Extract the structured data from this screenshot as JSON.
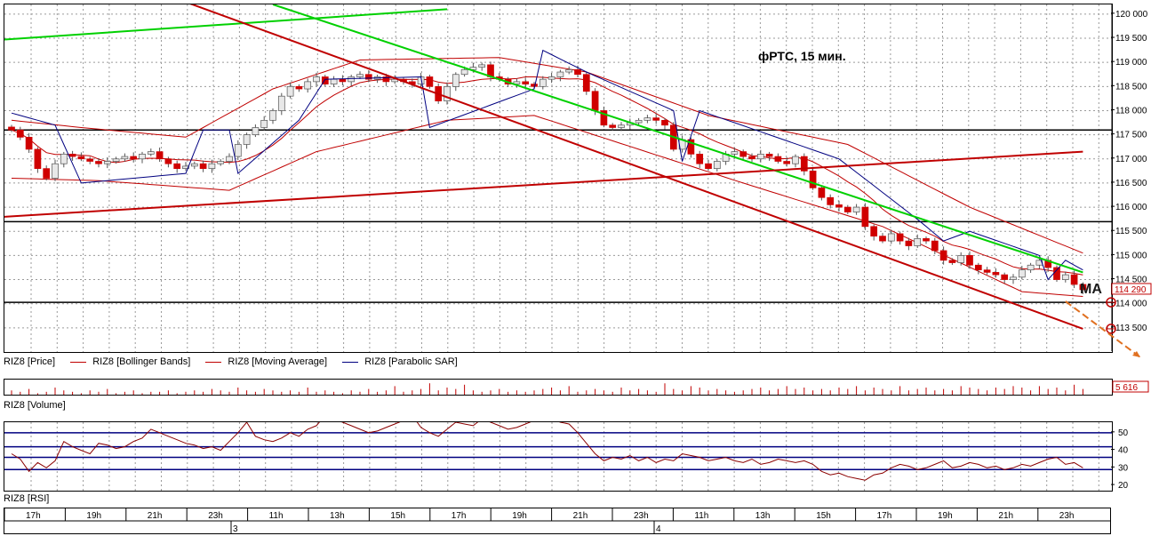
{
  "chart_data": [
    {
      "panel": "price",
      "type": "candlestick",
      "title": "фРТС, 15 мин.",
      "annotation": "MA",
      "ylim": [
        113000,
        120200
      ],
      "y_ticks": [
        113500,
        114000,
        114500,
        115000,
        115500,
        116000,
        116500,
        117000,
        117500,
        118000,
        118500,
        119000,
        119500,
        120000
      ],
      "y_tick_labels": [
        "113 500",
        "114 000",
        "114 500",
        "115 000",
        "115 500",
        "116 000",
        "116 500",
        "117 000",
        "117 500",
        "118 000",
        "118 500",
        "119 000",
        "119 500",
        "120 000"
      ],
      "last_price_label": "114 290",
      "last_price": 114290,
      "horizontal_levels": [
        117600,
        115700,
        114030
      ],
      "grid": true,
      "legend": [
        "RIZ8 [Price]",
        "RIZ8 [Bollinger Bands]",
        "RIZ8 [Moving Average]",
        "RIZ8 [Parabolic SAR]"
      ],
      "close": [
        117600,
        117450,
        117200,
        116800,
        116600,
        116900,
        117100,
        117050,
        117000,
        116950,
        116900,
        116950,
        117000,
        117050,
        117000,
        117100,
        117150,
        117000,
        116900,
        116800,
        116850,
        116900,
        116800,
        116900,
        116950,
        117050,
        117300,
        117500,
        117650,
        117800,
        118000,
        118300,
        118500,
        118450,
        118600,
        118700,
        118550,
        118650,
        118600,
        118700,
        118750,
        118650,
        118700,
        118600,
        118650,
        118600,
        118550,
        118700,
        118500,
        118200,
        118500,
        118750,
        118850,
        118900,
        118950,
        118700,
        118650,
        118550,
        118600,
        118550,
        118500,
        118650,
        118700,
        118800,
        118850,
        118750,
        118400,
        118000,
        117700,
        117650,
        117700,
        117750,
        117800,
        117850,
        117800,
        117700,
        117200,
        117400,
        117100,
        116900,
        116800,
        116950,
        117100,
        117150,
        117050,
        117000,
        117100,
        117050,
        116950,
        116900,
        117050,
        116750,
        116400,
        116200,
        116050,
        116000,
        115900,
        116000,
        115600,
        115400,
        115300,
        115450,
        115300,
        115200,
        115350,
        115300,
        115100,
        114900,
        114850,
        115000,
        114800,
        114700,
        114650,
        114600,
        114500,
        114550,
        114700,
        114800,
        114900,
        114750,
        114500,
        114600,
        114400,
        114290
      ],
      "bollinger_upper_knots": [
        [
          0,
          117800
        ],
        [
          8,
          117650
        ],
        [
          20,
          117450
        ],
        [
          30,
          118450
        ],
        [
          40,
          119050
        ],
        [
          56,
          119100
        ],
        [
          66,
          118800
        ],
        [
          80,
          117900
        ],
        [
          96,
          117300
        ],
        [
          110,
          116000
        ],
        [
          123,
          115050
        ]
      ],
      "bollinger_lower_knots": [
        [
          0,
          116600
        ],
        [
          10,
          116550
        ],
        [
          25,
          116350
        ],
        [
          35,
          117150
        ],
        [
          50,
          117800
        ],
        [
          60,
          117900
        ],
        [
          72,
          117200
        ],
        [
          84,
          116500
        ],
        [
          100,
          115600
        ],
        [
          116,
          114250
        ],
        [
          123,
          114150
        ]
      ],
      "sar_knots": [
        [
          0,
          117950
        ],
        [
          5,
          117700
        ],
        [
          8,
          116500
        ],
        [
          20,
          116700
        ],
        [
          22,
          117600
        ],
        [
          25,
          117600
        ],
        [
          26,
          116700
        ],
        [
          33,
          117800
        ],
        [
          36,
          118650
        ],
        [
          47,
          118700
        ],
        [
          48,
          117650
        ],
        [
          60,
          118450
        ],
        [
          61,
          119250
        ],
        [
          66,
          118800
        ],
        [
          76,
          118000
        ],
        [
          77,
          116950
        ],
        [
          79,
          118000
        ],
        [
          95,
          117000
        ],
        [
          104,
          115750
        ],
        [
          107,
          115300
        ],
        [
          110,
          115500
        ],
        [
          118,
          115000
        ],
        [
          119,
          114500
        ],
        [
          121,
          114900
        ],
        [
          123,
          114700
        ]
      ],
      "trendlines": [
        {
          "color": "#00d000",
          "from": [
            -1,
            119470
          ],
          "to": [
            50,
            120100
          ]
        },
        {
          "color": "#00d000",
          "from": [
            30,
            120200
          ],
          "to": [
            123,
            114650
          ]
        },
        {
          "color": "#c00000",
          "from": [
            -1,
            115800
          ],
          "to": [
            123,
            117150
          ]
        },
        {
          "color": "#c00000",
          "from": [
            20,
            120250
          ],
          "to": [
            123,
            113480
          ]
        }
      ],
      "forecast_arrows": [
        {
          "color": "#e07020",
          "from": [
            121,
            114050
          ],
          "to": [
            125,
            113200
          ]
        }
      ]
    },
    {
      "panel": "volume",
      "type": "bar",
      "legend": "RIZ8 [Volume]",
      "last_value_label": "5 616",
      "values_relative": [
        3,
        2,
        4,
        1,
        2,
        5,
        3,
        2,
        1,
        3,
        2,
        4,
        1,
        2,
        3,
        1,
        2,
        2,
        3,
        1,
        2,
        3,
        2,
        4,
        3,
        2,
        5,
        3,
        2,
        4,
        3,
        2,
        3,
        2,
        5,
        2,
        3,
        2,
        1,
        3,
        2,
        4,
        2,
        3,
        6,
        2,
        3,
        4,
        8,
        3,
        5,
        4,
        7,
        3,
        2,
        3,
        4,
        2,
        3,
        2,
        3,
        4,
        5,
        3,
        6,
        2,
        3,
        4,
        3,
        2,
        5,
        3,
        4,
        3,
        2,
        8,
        4,
        3,
        6,
        5,
        3,
        4,
        3,
        2,
        3,
        4,
        5,
        3,
        4,
        6,
        4,
        5,
        3,
        4,
        3,
        5,
        4,
        6,
        3,
        5,
        4,
        3,
        6,
        3,
        4,
        5,
        3,
        4,
        3,
        6,
        5,
        4,
        3,
        5,
        4,
        6,
        5,
        3,
        6,
        4,
        5,
        3,
        7,
        4
      ]
    },
    {
      "panel": "rsi",
      "type": "line",
      "legend": "RIZ8 [RSI]",
      "ylim": [
        17,
        56
      ],
      "y_ticks": [
        20,
        30,
        40,
        50
      ],
      "y_tick_labels": [
        "20",
        "30",
        "40",
        "50"
      ],
      "levels": [
        50,
        42,
        36,
        29
      ],
      "values": [
        38,
        35,
        28,
        33,
        30,
        34,
        45,
        42,
        40,
        38,
        44,
        43,
        41,
        42,
        45,
        47,
        52,
        50,
        48,
        46,
        44,
        43,
        41,
        42,
        40,
        45,
        50,
        56,
        48,
        46,
        45,
        47,
        50,
        48,
        52,
        54,
        60,
        58,
        56,
        54,
        52,
        50,
        51,
        53,
        55,
        57,
        60,
        53,
        50,
        48,
        52,
        56,
        55,
        54,
        58,
        56,
        54,
        52,
        53,
        55,
        57,
        60,
        58,
        56,
        55,
        50,
        44,
        38,
        34,
        36,
        35,
        37,
        34,
        36,
        33,
        35,
        34,
        38,
        37,
        36,
        34,
        35,
        36,
        34,
        33,
        35,
        32,
        33,
        35,
        34,
        33,
        34,
        32,
        28,
        26,
        27,
        25,
        24,
        23,
        26,
        27,
        30,
        32,
        31,
        29,
        30,
        32,
        34,
        30,
        31,
        33,
        32,
        30,
        31,
        29,
        30,
        32,
        31,
        33,
        35,
        36,
        32,
        33,
        30
      ]
    }
  ],
  "time_axis": {
    "hour_labels": [
      "17h",
      "19h",
      "21h",
      "23h",
      "11h",
      "13h",
      "15h",
      "17h",
      "19h",
      "21h",
      "23h",
      "11h",
      "13h",
      "15h",
      "17h",
      "19h",
      "21h",
      "23h"
    ],
    "day_labels": [
      "3",
      "4"
    ]
  },
  "colors": {
    "bullish": "#e8e8e8",
    "bearish": "#d00000",
    "bollinger": "#c00000",
    "moving_average": "#c00000",
    "sar": "#000080",
    "green_line": "#00d000",
    "red_line": "#c00000",
    "rsi_line": "#8b0000",
    "rsi_levels": "#000080",
    "arrow": "#e07020"
  }
}
